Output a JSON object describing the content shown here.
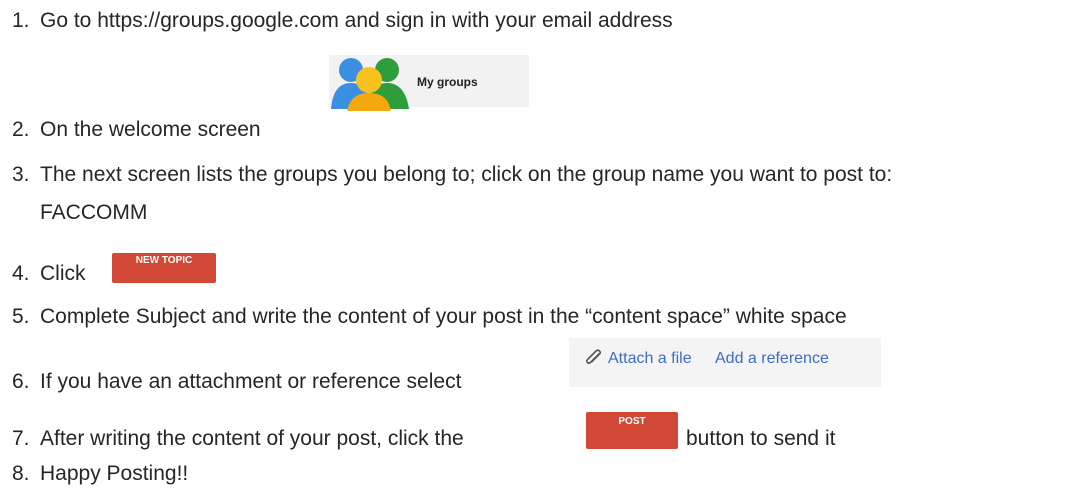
{
  "steps": [
    {
      "num": "1.",
      "text": "Go to https://groups.google.com and sign in with your email address"
    },
    {
      "num": "2.",
      "text": "On the welcome screen"
    },
    {
      "num": "3.",
      "text": "The next screen lists the groups you belong to; click on the group name you want to post to:",
      "cont": "FACCOMM"
    },
    {
      "num": "4.",
      "text": "Click"
    },
    {
      "num": "5.",
      "text": "Complete Subject and write the content of your post in the “content space” white space"
    },
    {
      "num": "6.",
      "text": "If you have an attachment or reference select"
    },
    {
      "num": "7.",
      "text": "After writing the content of your post, click the",
      "after": "button to send it"
    },
    {
      "num": "8.",
      "text": "Happy Posting!!"
    }
  ],
  "my_groups": {
    "label": "My groups",
    "icon": "people-icon"
  },
  "new_topic": {
    "label": "NEW TOPIC"
  },
  "attach": {
    "attach_label": "Attach a file",
    "reference_label": "Add a reference",
    "icon": "paperclip-icon"
  },
  "post": {
    "label": "POST"
  },
  "colors": {
    "red_button": "#d14836",
    "link_blue": "#3b6ec4"
  }
}
